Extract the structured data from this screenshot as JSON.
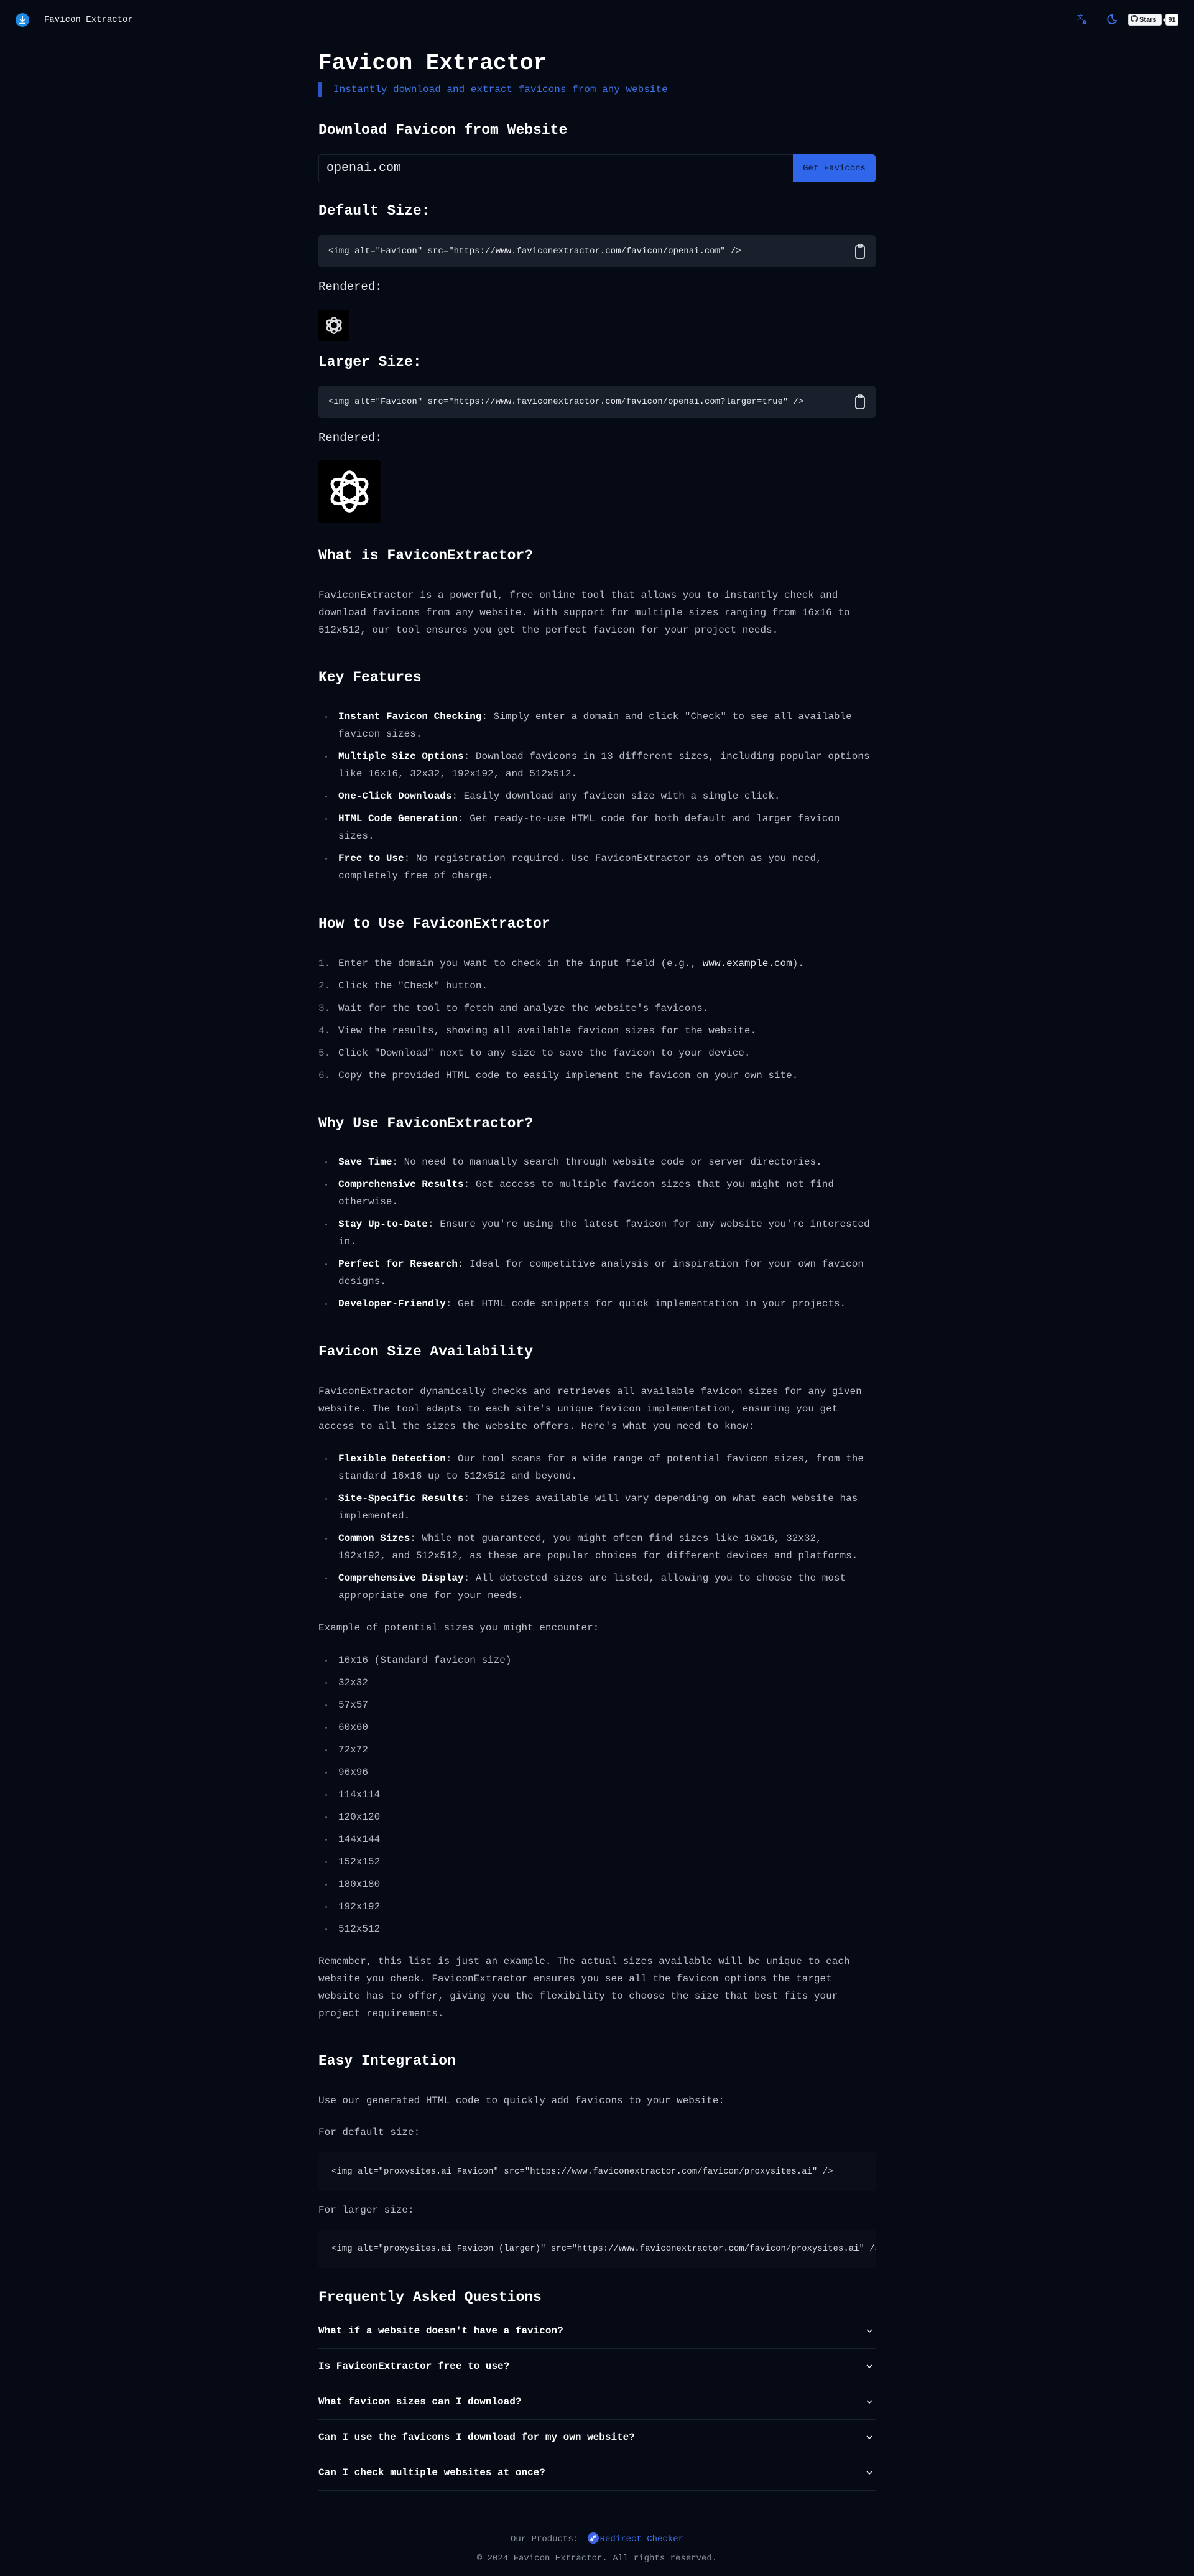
{
  "header": {
    "brand": "Favicon Extractor",
    "icons": [
      "download-logo-icon",
      "translate-icon",
      "moon-icon",
      "github-icon"
    ],
    "github_stars_label": "Stars",
    "github_stars_count": "91"
  },
  "hero": {
    "title": "Favicon Extractor",
    "subtitle": "Instantly download and extract favicons from any website"
  },
  "download": {
    "heading": "Download Favicon from Website",
    "input_value": "openai.com",
    "button_label": "Get Favicons",
    "default_heading": "Default Size:",
    "default_code": "<img alt=\"Favicon\" src=\"https://www.faviconextractor.com/favicon/openai.com\" />",
    "rendered_label": "Rendered:",
    "larger_heading": "Larger Size:",
    "larger_code": "<img alt=\"Favicon\" src=\"https://www.faviconextractor.com/favicon/openai.com?larger=true\" />"
  },
  "what_is": {
    "heading": "What is FaviconExtractor?",
    "text": "FaviconExtractor is a powerful, free online tool that allows you to instantly check and download favicons from any website. With support for multiple sizes ranging from 16x16 to 512x512, our tool ensures you get the perfect favicon for your project needs."
  },
  "features": {
    "heading": "Key Features",
    "items": [
      {
        "label": "Instant Favicon Checking",
        "text": ": Simply enter a domain and click \"Check\" to see all available favicon sizes."
      },
      {
        "label": "Multiple Size Options",
        "text": ": Download favicons in 13 different sizes, including popular options like 16x16, 32x32, 192x192, and 512x512."
      },
      {
        "label": "One-Click Downloads",
        "text": ": Easily download any favicon size with a single click."
      },
      {
        "label": "HTML Code Generation",
        "text": ": Get ready-to-use HTML code for both default and larger favicon sizes."
      },
      {
        "label": "Free to Use",
        "text": ": No registration required. Use FaviconExtractor as often as you need, completely free of charge."
      }
    ]
  },
  "how_to": {
    "heading": "How to Use FaviconExtractor",
    "step1_pre": "Enter the domain you want to check in the input field (e.g., ",
    "step1_link": "www.example.com",
    "step1_post": ").",
    "steps": [
      "Click the \"Check\" button.",
      "Wait for the tool to fetch and analyze the website's favicons.",
      "View the results, showing all available favicon sizes for the website.",
      "Click \"Download\" next to any size to save the favicon to your device.",
      "Copy the provided HTML code to easily implement the favicon on your own site."
    ]
  },
  "why": {
    "heading": "Why Use FaviconExtractor?",
    "items": [
      {
        "label": "Save Time",
        "text": ": No need to manually search through website code or server directories."
      },
      {
        "label": "Comprehensive Results",
        "text": ": Get access to multiple favicon sizes that you might not find otherwise."
      },
      {
        "label": "Stay Up-to-Date",
        "text": ": Ensure you're using the latest favicon for any website you're interested in."
      },
      {
        "label": "Perfect for Research",
        "text": ": Ideal for competitive analysis or inspiration for your own favicon designs."
      },
      {
        "label": "Developer-Friendly",
        "text": ": Get HTML code snippets for quick implementation in your projects."
      }
    ]
  },
  "availability": {
    "heading": "Favicon Size Availability",
    "intro": "FaviconExtractor dynamically checks and retrieves all available favicon sizes for any given website. The tool adapts to each site's unique favicon implementation, ensuring you get access to all the sizes the website offers. Here's what you need to know:",
    "items": [
      {
        "label": "Flexible Detection",
        "text": ": Our tool scans for a wide range of potential favicon sizes, from the standard 16x16 up to 512x512 and beyond."
      },
      {
        "label": "Site-Specific Results",
        "text": ": The sizes available will vary depending on what each website has implemented."
      },
      {
        "label": "Common Sizes",
        "text": ": While not guaranteed, you might often find sizes like 16x16, 32x32, 192x192, and 512x512, as these are popular choices for different devices and platforms."
      },
      {
        "label": "Comprehensive Display",
        "text": ": All detected sizes are listed, allowing you to choose the most appropriate one for your needs."
      }
    ],
    "example_intro": "Example of potential sizes you might encounter:",
    "sizes": [
      "16x16 (Standard favicon size)",
      "32x32",
      "57x57",
      "60x60",
      "72x72",
      "96x96",
      "114x114",
      "120x120",
      "144x144",
      "152x152",
      "180x180",
      "192x192",
      "512x512"
    ],
    "outro": "Remember, this list is just an example. The actual sizes available will be unique to each website you check. FaviconExtractor ensures you see all the favicon options the target website has to offer, giving you the flexibility to choose the size that best fits your project requirements."
  },
  "integration": {
    "heading": "Easy Integration",
    "intro": "Use our generated HTML code to quickly add favicons to your website:",
    "default_label": "For default size:",
    "default_code": "<img alt=\"proxysites.ai Favicon\" src=\"https://www.faviconextractor.com/favicon/proxysites.ai\" />",
    "larger_label": "For larger size:",
    "larger_code": "<img alt=\"proxysites.ai Favicon (larger)\" src=\"https://www.faviconextractor.com/favicon/proxysites.ai\" />"
  },
  "faq": {
    "heading": "Frequently Asked Questions",
    "questions": [
      "What if a website doesn't have a favicon?",
      "Is FaviconExtractor free to use?",
      "What favicon sizes can I download?",
      "Can I use the favicons I download for my own website?",
      "Can I check multiple websites at once?"
    ]
  },
  "footer": {
    "products_label": "Our Products:",
    "product_link": "Redirect Checker",
    "copyright": "© 2024 Favicon Extractor. All rights reserved."
  },
  "colors": {
    "background": "#050a14",
    "accent": "#2f66ea",
    "subtitle": "#3f73e8",
    "code_bg": "#1a1f2c"
  }
}
